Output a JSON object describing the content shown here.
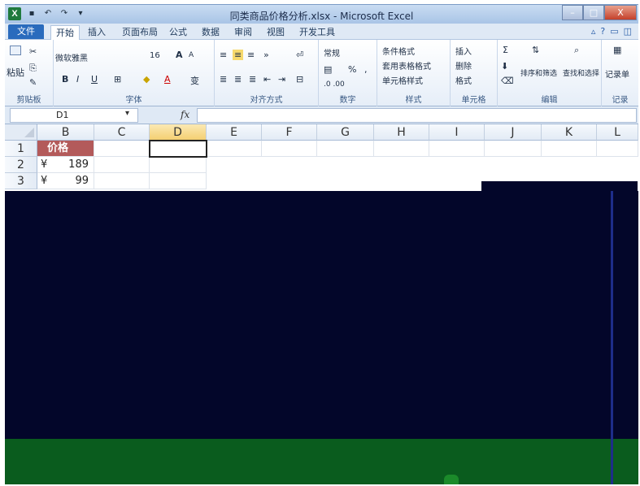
{
  "window": {
    "title": "同类商品价格分析.xlsx - Microsoft Excel",
    "app_icon": "X",
    "controls": {
      "minimize": "–",
      "maximize": "□",
      "close": "X"
    }
  },
  "tabs": [
    {
      "label": "文件"
    },
    {
      "label": "开始"
    },
    {
      "label": "插入"
    },
    {
      "label": "页面布局"
    },
    {
      "label": "公式"
    },
    {
      "label": "数据"
    },
    {
      "label": "审阅"
    },
    {
      "label": "视图"
    },
    {
      "label": "开发工具"
    }
  ],
  "ribbon": {
    "clipboard": {
      "paste_label": "粘贴",
      "group_label": "剪贴板"
    },
    "font": {
      "font_name": "微软雅黑",
      "font_size": "16",
      "bold": "B",
      "italic": "I",
      "underline": "U",
      "grow": "A",
      "shrink": "A",
      "font_color": "A",
      "wen": "变",
      "group_label": "字体"
    },
    "alignment": {
      "group_label": "对齐方式"
    },
    "number": {
      "format": "常规",
      "percent": "%",
      "comma": ",",
      "inc": ".0 .00",
      "group_label": "数字"
    },
    "styles": {
      "cond": "条件格式",
      "table": "套用表格格式",
      "cell": "单元格样式",
      "group_label": "样式"
    },
    "cells": {
      "insert": "插入",
      "delete": "删除",
      "format": "格式",
      "group_label": "单元格"
    },
    "editing": {
      "sum": "Σ",
      "sort": "排序和筛选",
      "find": "查找和选择",
      "group_label": "编辑"
    },
    "record": {
      "label": "记录单",
      "group_label": "记录"
    }
  },
  "formula_bar": {
    "name_box": "D1",
    "fx": "fx",
    "value": ""
  },
  "grid": {
    "columns": [
      "B",
      "C",
      "D",
      "E",
      "F",
      "G",
      "H",
      "I",
      "J",
      "K",
      "L"
    ],
    "selected_column": "D",
    "rows": [
      {
        "num": "1",
        "header": "价格"
      },
      {
        "num": "2",
        "currency": "¥",
        "value": "189"
      },
      {
        "num": "3",
        "currency": "¥",
        "value": "99"
      }
    ]
  },
  "colors": {
    "header_fill": "#b35a5a",
    "selected_col": "#f4cf72",
    "dark_region": "#03062a",
    "green_region": "#0a5c1e"
  }
}
